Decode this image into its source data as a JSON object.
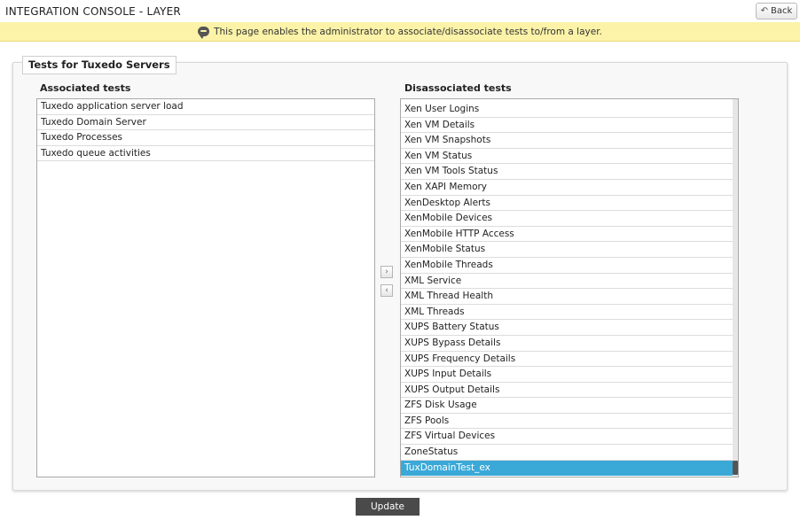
{
  "header": {
    "title": "INTEGRATION CONSOLE - LAYER",
    "back_label": "Back"
  },
  "info": {
    "message": "This page enables the administrator to associate/disassociate tests to/from a layer.",
    "icon": "speech-bubble-icon"
  },
  "panel": {
    "legend": "Tests for Tuxedo Servers",
    "associated_label": "Associated tests",
    "disassociated_label": "Disassociated tests"
  },
  "associated_tests": [
    "Tuxedo application server load",
    "Tuxedo Domain Server",
    "Tuxedo Processes",
    "Tuxedo queue activities"
  ],
  "disassociated_tests": [
    "Xen User Logins",
    "Xen VM Details",
    "Xen VM Snapshots",
    "Xen VM Status",
    "Xen VM Tools Status",
    "Xen XAPI Memory",
    "XenDesktop Alerts",
    "XenMobile Devices",
    "XenMobile HTTP Access",
    "XenMobile Status",
    "XenMobile Threads",
    "XML Service",
    "XML Thread Health",
    "XML Threads",
    "XUPS Battery Status",
    "XUPS Bypass Details",
    "XUPS Frequency Details",
    "XUPS Input Details",
    "XUPS Output Details",
    "ZFS Disk Usage",
    "ZFS Pools",
    "ZFS Virtual Devices",
    "ZoneStatus",
    "TuxDomainTest_ex"
  ],
  "selected_disassociated": "TuxDomainTest_ex",
  "controls": {
    "move_right": "›",
    "move_left": "‹",
    "update_label": "Update"
  },
  "colors": {
    "selection": "#3aa9d8",
    "info_background": "#fcf3a8",
    "update_button": "#4a4a4a"
  }
}
